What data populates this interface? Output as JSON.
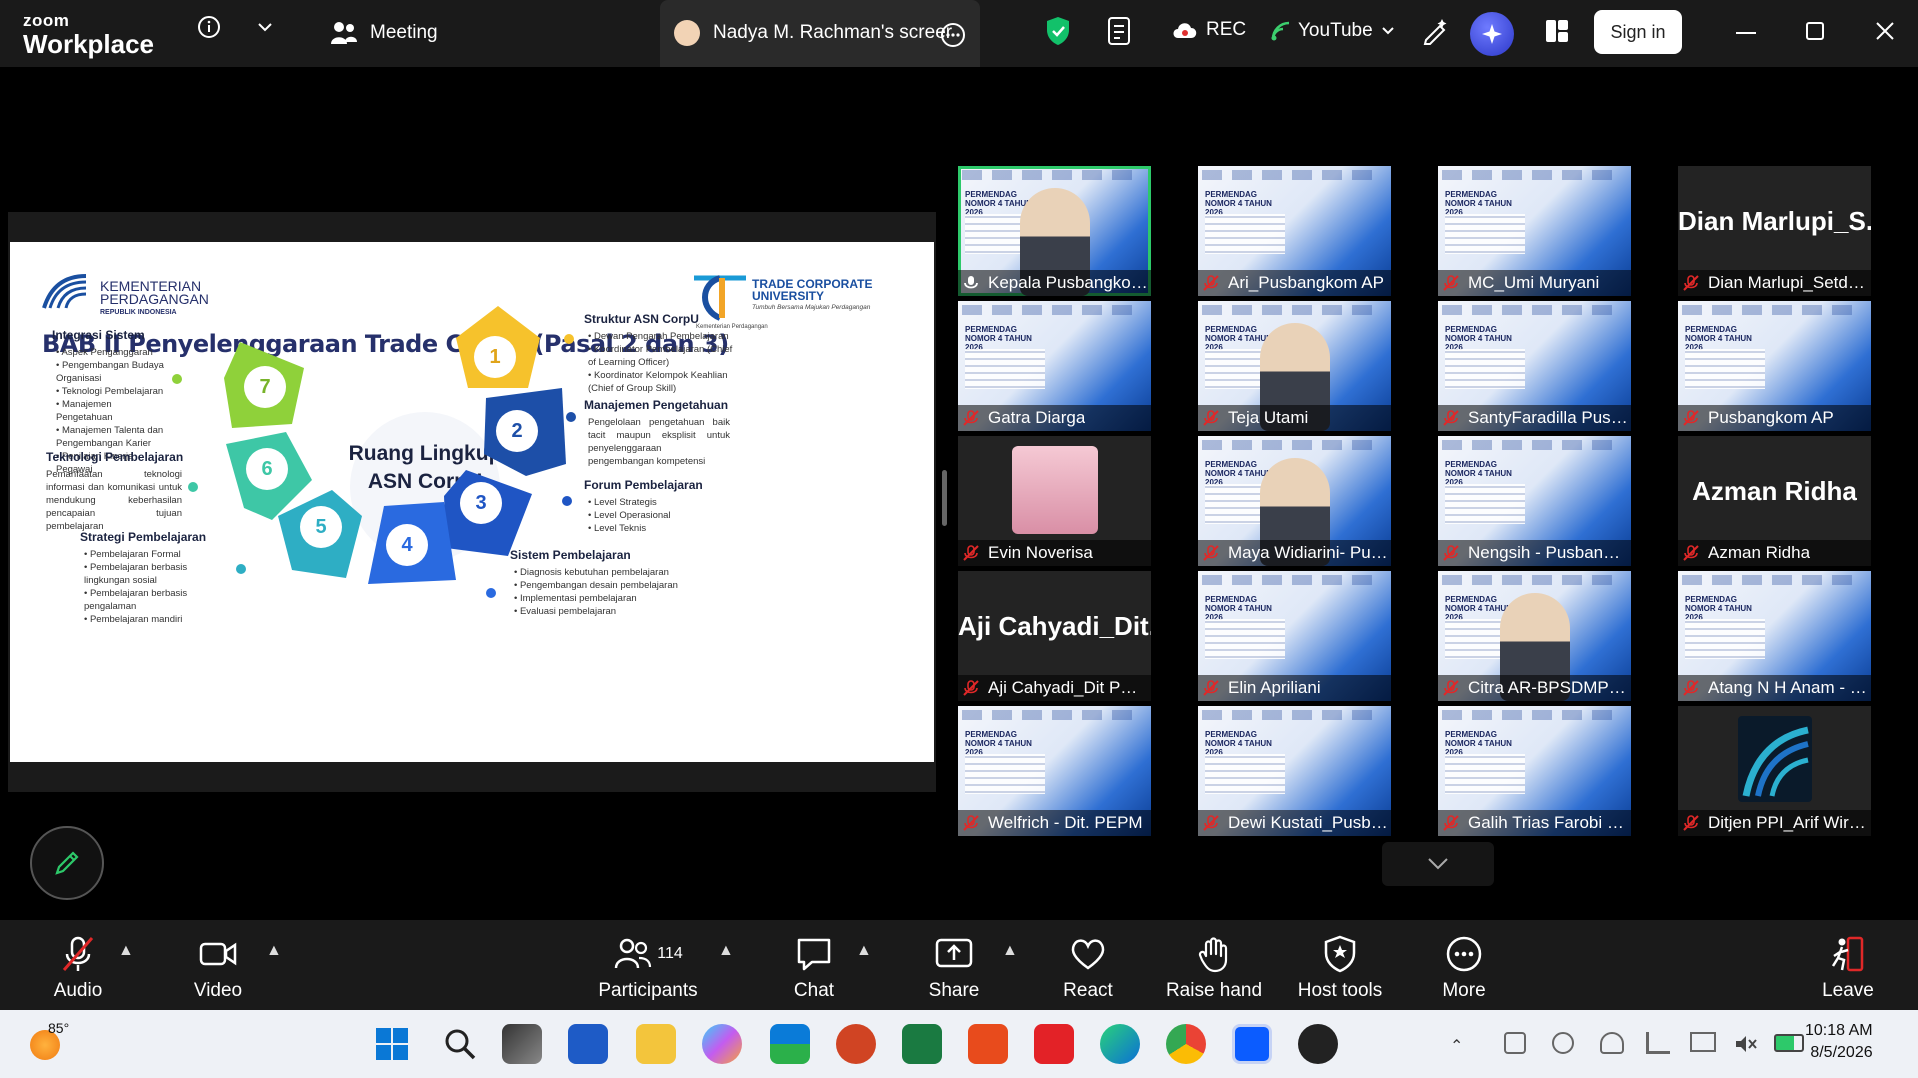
{
  "app": {
    "logo_small": "zoom",
    "logo_big": "Workplace"
  },
  "topbar": {
    "meeting_label": "Meeting",
    "share_tab_label": "Nadya M. Rachman's screer",
    "rec_label": "REC",
    "youtube_label": "YouTube",
    "signin_label": "Sign in"
  },
  "slide": {
    "ministry_line1": "KEMENTERIAN",
    "ministry_line2": "PERDAGANGAN",
    "ministry_line3": "REPUBLIK INDONESIA",
    "tcu_line1": "TRADE CORPORATE",
    "tcu_line2": "UNIVERSITY",
    "tcu_tagline": "Tumbuh Bersama Majukan Perdagangan",
    "tcu_sub": "Kementerian Perdagangan",
    "heading": "BAB II Penyelenggaraan Trade CorpU (Pasal 2 dan 3)",
    "center_line1": "Ruang Lingkup",
    "center_line2": "ASN CorpU",
    "numbers": [
      "1",
      "2",
      "3",
      "4",
      "5",
      "6",
      "7"
    ],
    "sections": {
      "struktur": {
        "title": "Struktur ASN CorpU",
        "items": [
          "Dewan Pengarah Pembelajaran",
          "Koordinator Pembelajaran (Chief of Learning Officer)",
          "Koordinator Kelompok Keahlian (Chief of Group Skill)"
        ]
      },
      "manajemen": {
        "title": "Manajemen Pengetahuan",
        "text": "Pengelolaan pengetahuan baik tacit maupun eksplisit untuk penyelenggaraan pengembangan kompetensi"
      },
      "forum": {
        "title": "Forum Pembelajaran",
        "items": [
          "Level Strategis",
          "Level Operasional",
          "Level Teknis"
        ]
      },
      "sistem": {
        "title": "Sistem Pembelajaran",
        "items": [
          "Diagnosis kebutuhan pembelajaran",
          "Pengembangan desain pembelajaran",
          "Implementasi pembelajaran",
          "Evaluasi pembelajaran"
        ]
      },
      "integrasi": {
        "title": "Integrasi Sistem",
        "items": [
          "Aspek Penganggaran",
          "Pengembangan Budaya Organisasi",
          "Teknologi Pembelajaran",
          "Manajemen Pengetahuan",
          "Manajemen Talenta dan Pengembangan Karier",
          "Penilaian Kinerja Pegawai"
        ]
      },
      "teknologi": {
        "title": "Teknologi Pembelajaran",
        "text": "Pemanfaatan teknologi informasi dan komunikasi untuk mendukung keberhasilan pencapaian tujuan pembelajaran"
      },
      "strategi": {
        "title": "Strategi Pembelajaran",
        "items": [
          "Pembelajaran Formal",
          "Pembelajaran berbasis lingkungan sosial",
          "Pembelajaran berbasis pengalaman",
          "Pembelajaran mandiri"
        ]
      }
    }
  },
  "gallery": {
    "mini_slide_title": "PERMENDAG NOMOR 4 TAHUN 2026",
    "tiles": [
      {
        "name": "Kepala Pusbangkom AP",
        "kind": "video",
        "active": true
      },
      {
        "name": "Ari_Pusbangkom AP",
        "kind": "slide"
      },
      {
        "name": "MC_Umi Muryani",
        "kind": "slide"
      },
      {
        "name": "Dian Marlupi_Setditje...",
        "kind": "text",
        "big": "Dian Marlupi_S..."
      },
      {
        "name": "Gatra Diarga",
        "kind": "slide"
      },
      {
        "name": "Teja Utami",
        "kind": "video"
      },
      {
        "name": "SantyFaradilla Pusban...",
        "kind": "slide"
      },
      {
        "name": "Pusbangkom AP",
        "kind": "slide"
      },
      {
        "name": "Evin Noverisa",
        "kind": "photo"
      },
      {
        "name": "Maya Widiarini- Pusdi...",
        "kind": "video"
      },
      {
        "name": "Nengsih - Pusbangko...",
        "kind": "slide"
      },
      {
        "name": "Azman Ridha",
        "kind": "text",
        "big": "Azman Ridha"
      },
      {
        "name": "Aji Cahyadi_Dit PEJPK_...",
        "kind": "text",
        "big": "Aji Cahyadi_Dit..."
      },
      {
        "name": "Elin Apriliani",
        "kind": "slide"
      },
      {
        "name": "Citra AR-BPSDMP-Ke...",
        "kind": "video"
      },
      {
        "name": "Atang N H Anam - Pus...",
        "kind": "slide"
      },
      {
        "name": "Welfrich - Dit. PEPM",
        "kind": "slide"
      },
      {
        "name": "Dewi Kustati_Pusbang...",
        "kind": "slide"
      },
      {
        "name": "Galih Trias Farobi - Ke...",
        "kind": "slide"
      },
      {
        "name": "Ditjen PPI_Arif Wiryaw...",
        "kind": "logo"
      }
    ]
  },
  "toolbar": {
    "audio": "Audio",
    "video": "Video",
    "participants": "Participants",
    "participants_count": "114",
    "chat": "Chat",
    "share": "Share",
    "react": "React",
    "raise_hand": "Raise hand",
    "host_tools": "Host tools",
    "more": "More",
    "leave": "Leave"
  },
  "taskbar": {
    "weather": "85°",
    "time": "10:18 AM",
    "date": "8/5/2026"
  },
  "colors": {
    "accent_green": "#2dc96a",
    "zoom_blue": "#0b5cff",
    "slide_navy": "#26306b"
  }
}
